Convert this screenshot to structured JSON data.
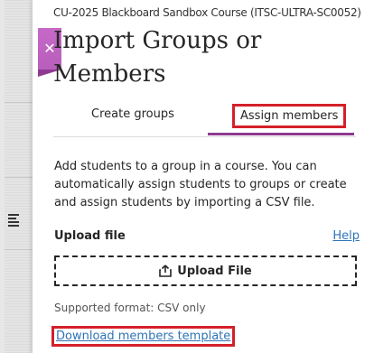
{
  "header": {
    "course_name": "CU-2025 Blackboard Sandbox Course (ITSC-ULTRA-SC0052)",
    "title": "Import Groups or Members",
    "close_icon": "close-icon"
  },
  "tabs": [
    {
      "label": "Create groups",
      "selected": false
    },
    {
      "label": "Assign members",
      "selected": true
    }
  ],
  "content": {
    "description": "Add students to a group in a course. You can automatically assign students to groups or create and assign students by importing a CSV file.",
    "upload_label": "Upload file",
    "help_label": "Help",
    "upload_button_label": "Upload File",
    "upload_icon": "upload-icon",
    "supported_format": "Supported format: CSV only",
    "download_link": "Download members template"
  },
  "colors": {
    "accent": "#8d3a90",
    "close_button": "#c767c7",
    "link": "#2e73b8",
    "highlight": "#d3202a"
  }
}
